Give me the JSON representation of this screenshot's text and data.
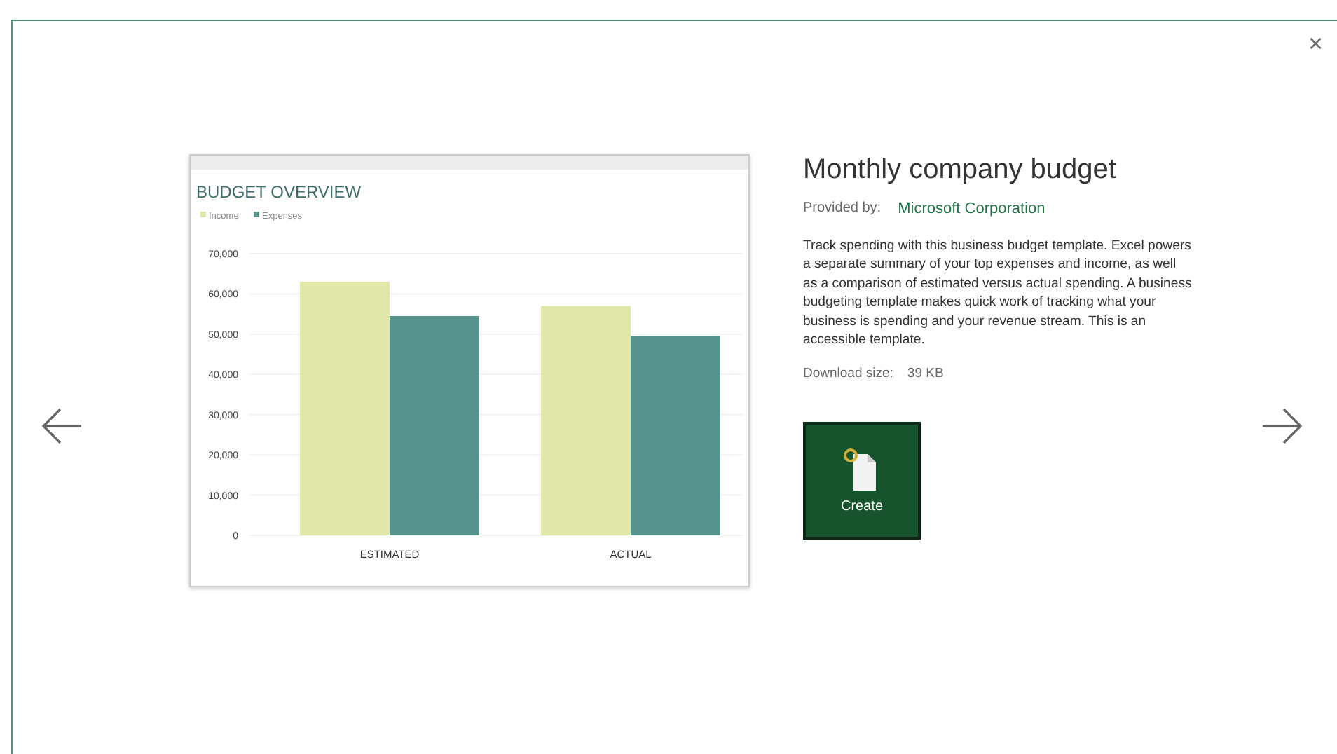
{
  "close_label": "×",
  "preview": {
    "chart_data": {
      "type": "bar",
      "title": "BUDGET OVERVIEW",
      "categories": [
        "ESTIMATED",
        "ACTUAL"
      ],
      "series": [
        {
          "name": "Income",
          "color": "#e1e6a9",
          "values": [
            63000,
            57000
          ]
        },
        {
          "name": "Expenses",
          "color": "#56938d",
          "values": [
            54500,
            49500
          ]
        }
      ],
      "grid": true,
      "legend": true,
      "ylim": [
        0,
        70000
      ],
      "yticks": [
        {
          "value": 0,
          "label": "0"
        },
        {
          "value": 10000,
          "label": "10,000"
        },
        {
          "value": 20000,
          "label": "20,000"
        },
        {
          "value": 30000,
          "label": "30,000"
        },
        {
          "value": 40000,
          "label": "40,000"
        },
        {
          "value": 50000,
          "label": "50,000"
        },
        {
          "value": 60000,
          "label": "60,000"
        },
        {
          "value": 70000,
          "label": "70,000"
        }
      ]
    }
  },
  "template": {
    "title": "Monthly company budget",
    "provider_label": "Provided by:",
    "provider": "Microsoft Corporation",
    "description": "Track spending with this business budget template. Excel powers a separate summary of your top expenses and income, as well as a comparison of estimated versus actual spending. A business budgeting template makes quick work of tracking what your business is spending and your revenue stream. This is an accessible template.",
    "size_label": "Download size:",
    "size": "39 KB",
    "create_label": "Create"
  }
}
